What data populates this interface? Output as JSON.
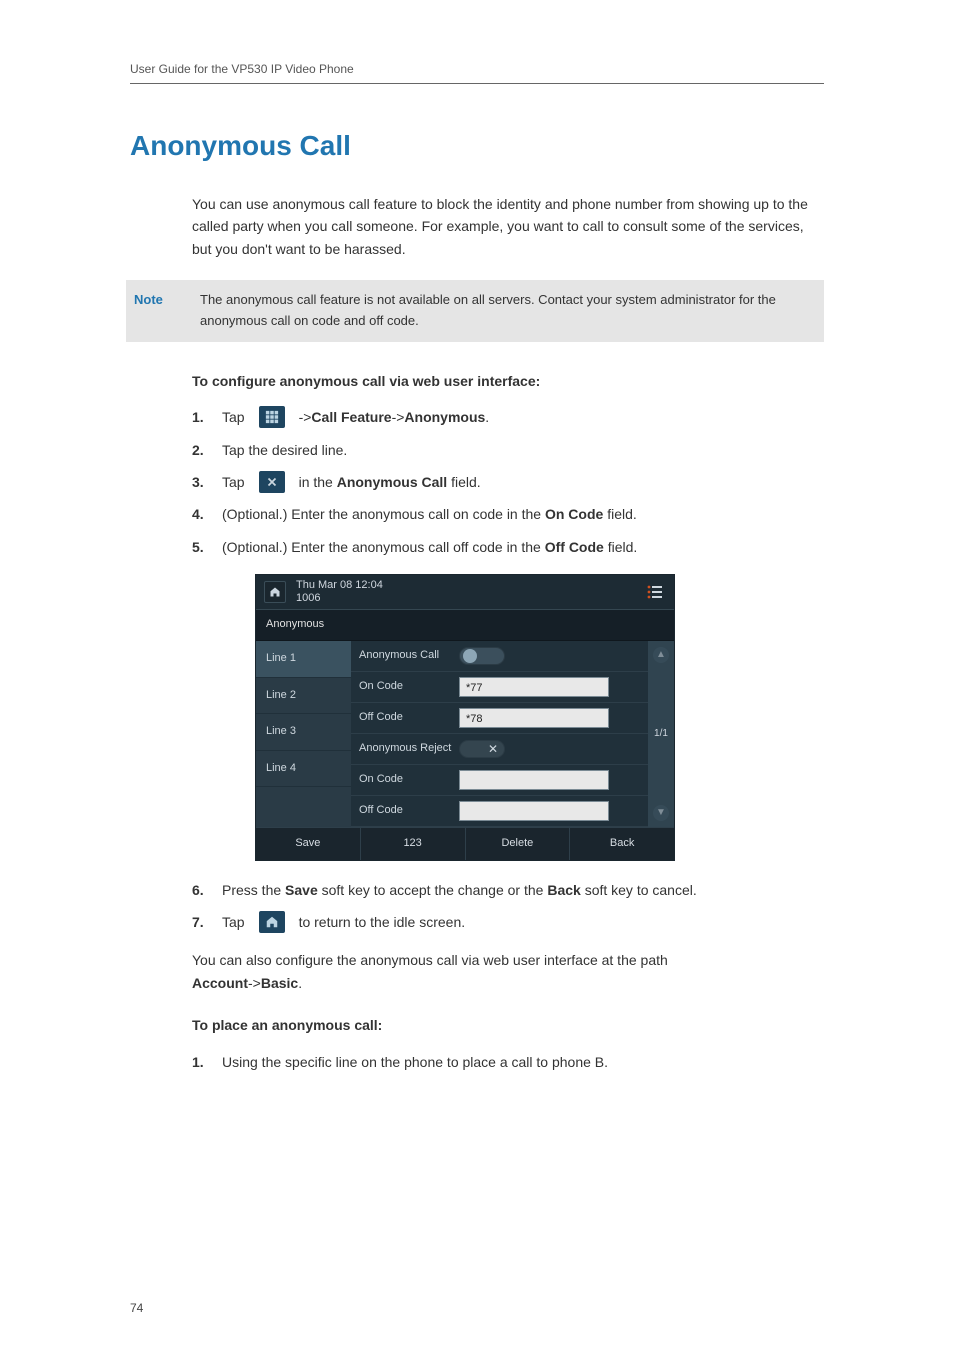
{
  "header": {
    "runner": "User Guide for the VP530 IP Video Phone"
  },
  "title": "Anonymous Call",
  "intro": "You can use anonymous call feature to block the identity and phone number from showing up to the called party when you call someone. For example, you want to call to consult some of the services, but you don't want to be harassed.",
  "note": {
    "label": "Note",
    "text": "The anonymous call feature is not available on all servers. Contact your system administrator for the anonymous call on code and off code."
  },
  "subheading1": "To configure anonymous call via web user interface:",
  "steps1": {
    "s1a": "Tap",
    "s1b": "->",
    "s1c": "Call Feature",
    "s1d": "->",
    "s1e": "Anonymous",
    "s1f": ".",
    "s2": "Tap the desired line.",
    "s3a": "Tap",
    "s3b": "in the",
    "s3c": "Anonymous Call",
    "s3d": "field.",
    "s4a": "(Optional.) Enter the anonymous call on code in the",
    "s4b": "On Code",
    "s4c": "field.",
    "s5a": "(Optional.) Enter the anonymous call off code in the",
    "s5b": "Off Code",
    "s5c": "field."
  },
  "screenshot": {
    "datetime": "Thu Mar 08 12:04",
    "ext": "1006",
    "titlebar": "Anonymous",
    "sidebar": [
      "Line 1",
      "Line 2",
      "Line 3",
      "Line 4"
    ],
    "rows": {
      "anonCall": "Anonymous Call",
      "onCode": "On Code",
      "offCode": "Off Code",
      "anonReject": "Anonymous Reject",
      "onCode2": "On Code",
      "offCode2": "Off Code"
    },
    "values": {
      "onCode": "*77",
      "offCode": "*78"
    },
    "page": "1/1",
    "softkeys": [
      "Save",
      "123",
      "Delete",
      "Back"
    ]
  },
  "steps2": {
    "s6a": "Press the",
    "s6b": "Save",
    "s6c": "soft key to accept the change or the",
    "s6d": "Back",
    "s6e": "soft key to cancel.",
    "s7a": "Tap",
    "s7b": "to return to the idle screen."
  },
  "afterText": {
    "a": "You can also configure the anonymous call via web user interface at the path",
    "b": "Account",
    "c": "->",
    "d": "Basic",
    "e": "."
  },
  "subheading2": "To place an anonymous call:",
  "steps3": {
    "s1": "Using the specific line on the phone to place a call to phone B."
  },
  "pageNumber": "74"
}
